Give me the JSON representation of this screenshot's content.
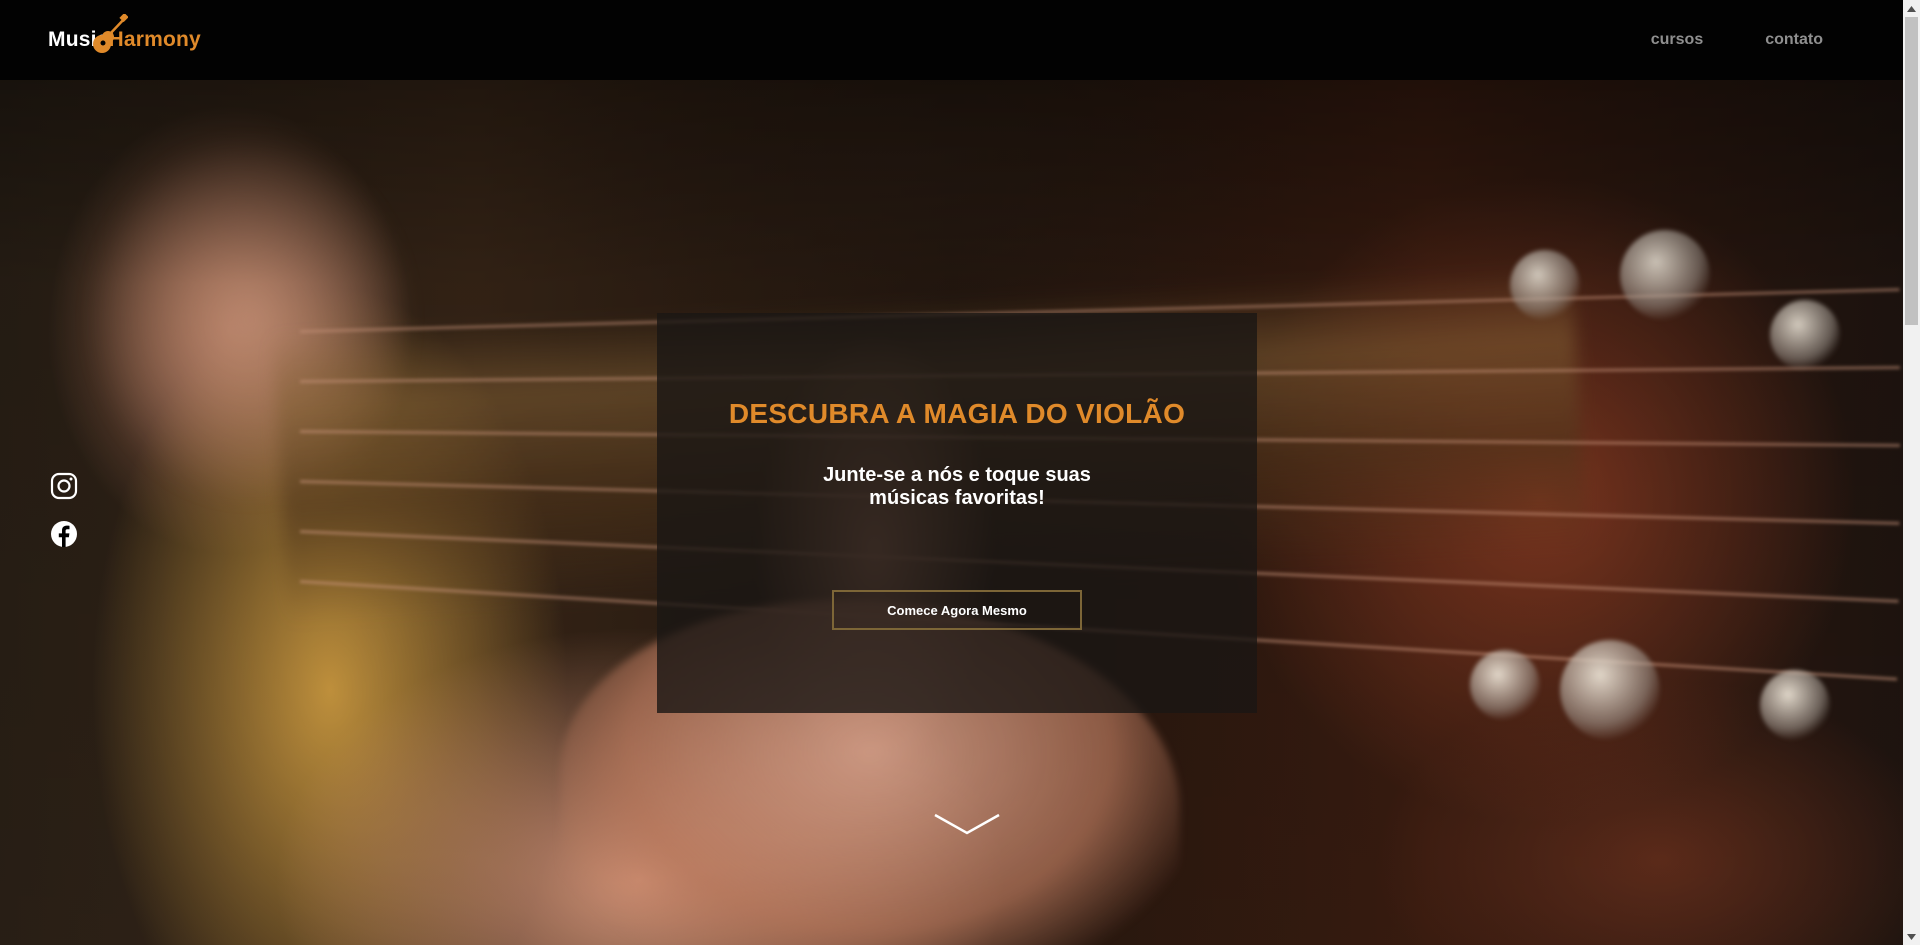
{
  "header": {
    "logo": {
      "word1": "Music",
      "word2": "Harmony",
      "icon": "guitar-icon"
    },
    "nav": [
      {
        "label": "cursos"
      },
      {
        "label": "contato"
      }
    ]
  },
  "social": [
    {
      "icon": "instagram-icon"
    },
    {
      "icon": "facebook-icon"
    }
  ],
  "hero": {
    "title": "DESCUBRA A MAGIA DO VIOLÃO",
    "subtitle": "Junte-se a nós e toque suas músicas favoritas!",
    "cta_label": "Comece Agora Mesmo",
    "scroll_icon": "chevron-down-icon"
  },
  "colors": {
    "accent": "#e08a2a",
    "nav_text": "#8f8f8f",
    "header_bg": "#020202",
    "button_border": "#7d6637"
  }
}
